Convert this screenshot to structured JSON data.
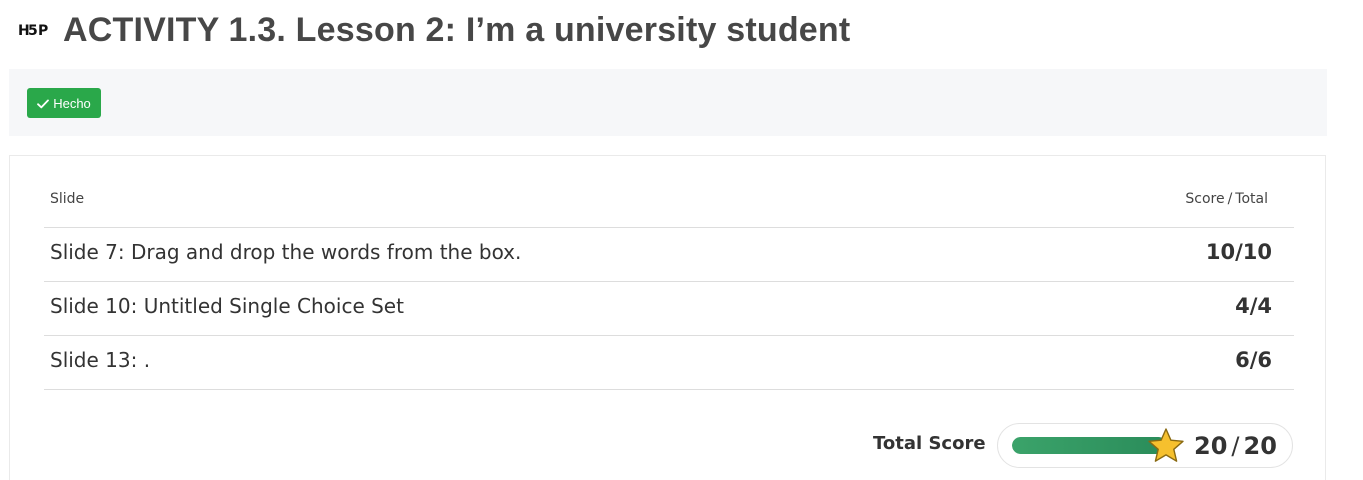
{
  "header": {
    "logo_icon": "h5p-logo-icon",
    "title": "ACTIVITY 1.3. Lesson 2: I’m a university student"
  },
  "toolbar": {
    "done_label": "Hecho",
    "done_icon": "check-icon",
    "done_color": "#2aa84a"
  },
  "summary": {
    "columns": {
      "slide": "Slide",
      "score": "Score",
      "score_separator": "/",
      "total": "Total"
    },
    "rows": [
      {
        "title": "Slide 7: Drag and drop the words from the box.",
        "score": "10/10"
      },
      {
        "title": "Slide 10: Untitled Single Choice Set",
        "score": "4/4"
      },
      {
        "title": "Slide 13: .",
        "score": "6/6"
      }
    ],
    "total": {
      "label": "Total Score",
      "score": "20",
      "separator": "/",
      "max": "20",
      "progress_fraction": 1.0,
      "bar_color": "#2a8c5a",
      "star_icon": "star-icon",
      "star_color": "#f6c02e"
    }
  }
}
